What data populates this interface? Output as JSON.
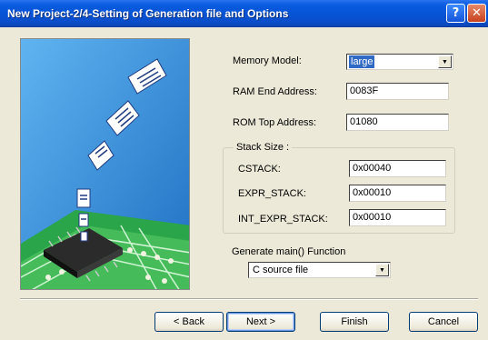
{
  "window": {
    "title": "New Project-2/4-Setting of Generation file and Options",
    "help_glyph": "?",
    "close_glyph": "✕"
  },
  "form": {
    "memory_model": {
      "label": "Memory Model:",
      "value": "large"
    },
    "ram_end_address": {
      "label": "RAM End Address:",
      "value": "0083F"
    },
    "rom_top_address": {
      "label": "ROM Top Address:",
      "value": "01080"
    },
    "stack_size": {
      "legend": "Stack Size :",
      "cstack": {
        "label": "CSTACK:",
        "value": "0x00040"
      },
      "expr_stack": {
        "label": "EXPR_STACK:",
        "value": "0x00010"
      },
      "int_expr_stack": {
        "label": "INT_EXPR_STACK:",
        "value": "0x00010"
      }
    },
    "generate_main": {
      "label": "Generate main() Function",
      "value": "C source file"
    }
  },
  "buttons": {
    "back": "< Back",
    "next": "Next >",
    "finish": "Finish",
    "cancel": "Cancel"
  },
  "dropdown_glyph": "▼"
}
